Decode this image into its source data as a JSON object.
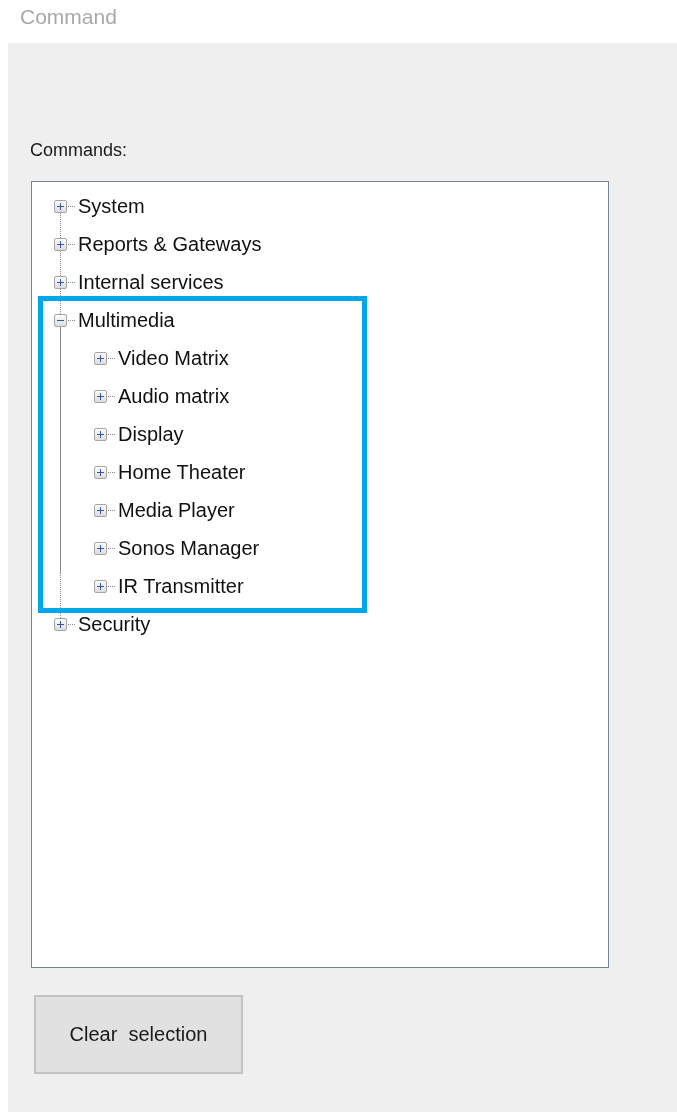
{
  "window": {
    "title": "Command"
  },
  "commands_label": "Commands:",
  "tree": [
    {
      "label": "System",
      "expanded": false,
      "highlighted": false
    },
    {
      "label": "Reports & Gateways",
      "expanded": false,
      "highlighted": false
    },
    {
      "label": "Internal services",
      "expanded": false,
      "highlighted": false
    },
    {
      "label": "Multimedia",
      "expanded": true,
      "highlighted": true,
      "children": [
        {
          "label": "Video Matrix",
          "expanded": false,
          "highlighted": false
        },
        {
          "label": "Audio matrix",
          "expanded": false,
          "highlighted": false
        },
        {
          "label": "Display",
          "expanded": false,
          "highlighted": false
        },
        {
          "label": "Home Theater",
          "expanded": false,
          "highlighted": false
        },
        {
          "label": "Media Player",
          "expanded": false,
          "highlighted": false
        },
        {
          "label": "Sonos Manager",
          "expanded": false,
          "highlighted": false
        },
        {
          "label": "IR Transmitter",
          "expanded": false,
          "highlighted": false
        }
      ]
    },
    {
      "label": "Security",
      "expanded": false,
      "highlighted": false
    }
  ],
  "buttons": [
    "Clear  selection"
  ]
}
